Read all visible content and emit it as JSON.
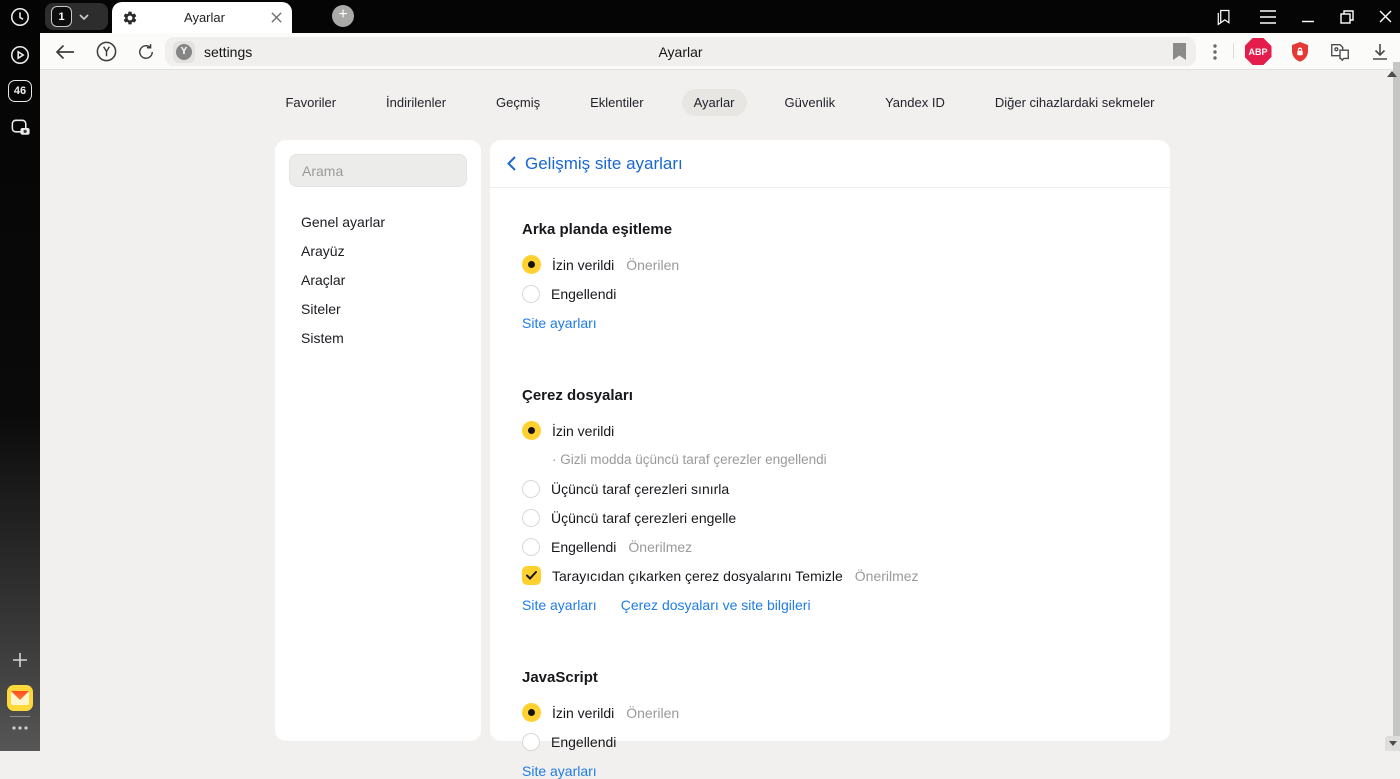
{
  "titlebar": {
    "tab_counter": "1",
    "tab_title": "Ayarlar",
    "new_tab": "+"
  },
  "toolbar": {
    "url_value": "settings",
    "centered_page_title": "Ayarlar",
    "abp_label": "ABP"
  },
  "rail": {
    "tab_count_badge": "46"
  },
  "nav": {
    "items": [
      {
        "label": "Favoriler"
      },
      {
        "label": "İndirilenler"
      },
      {
        "label": "Geçmiş"
      },
      {
        "label": "Eklentiler"
      },
      {
        "label": "Ayarlar",
        "active": true
      },
      {
        "label": "Güvenlik"
      },
      {
        "label": "Yandex ID"
      },
      {
        "label": "Diğer cihazlardaki sekmeler"
      }
    ]
  },
  "sidebar": {
    "search_placeholder": "Arama",
    "items": [
      {
        "label": "Genel ayarlar"
      },
      {
        "label": "Arayüz"
      },
      {
        "label": "Araçlar"
      },
      {
        "label": "Siteler"
      },
      {
        "label": "Sistem"
      }
    ]
  },
  "content": {
    "title": "Gelişmiş site ayarları",
    "sections": [
      {
        "title": "Arka planda eşitleme",
        "options": [
          {
            "type": "radio",
            "checked": true,
            "label": "İzin verildi",
            "badge": "Önerilen"
          },
          {
            "type": "radio",
            "checked": false,
            "label": "Engellendi"
          }
        ],
        "links": [
          "Site ayarları"
        ]
      },
      {
        "title": "Çerez dosyaları",
        "options": [
          {
            "type": "radio",
            "checked": true,
            "label": "İzin verildi",
            "note": "· Gizli modda üçüncü taraf çerezler engellendi"
          },
          {
            "type": "radio",
            "checked": false,
            "label": "Üçüncü taraf çerezleri sınırla"
          },
          {
            "type": "radio",
            "checked": false,
            "label": "Üçüncü taraf çerezleri engelle"
          },
          {
            "type": "radio",
            "checked": false,
            "label": "Engellendi",
            "badge": "Önerilmez"
          },
          {
            "type": "checkbox",
            "checked": true,
            "label": "Tarayıcıdan çıkarken çerez dosyalarını Temizle",
            "badge": "Önerilmez"
          }
        ],
        "links": [
          "Site ayarları",
          "Çerez dosyaları ve site bilgileri"
        ]
      },
      {
        "title": "JavaScript",
        "options": [
          {
            "type": "radio",
            "checked": true,
            "label": "İzin verildi",
            "badge": "Önerilen"
          },
          {
            "type": "radio",
            "checked": false,
            "label": "Engellendi"
          }
        ],
        "links": [
          "Site ayarları"
        ]
      }
    ]
  },
  "colors": {
    "accent_yellow": "#ffd130",
    "link_blue": "#1f7ce8",
    "heading_blue": "#1a67d2",
    "abp_red": "#e51d4c",
    "shield_red": "#e53935",
    "page_bg": "#f1f0ee"
  }
}
